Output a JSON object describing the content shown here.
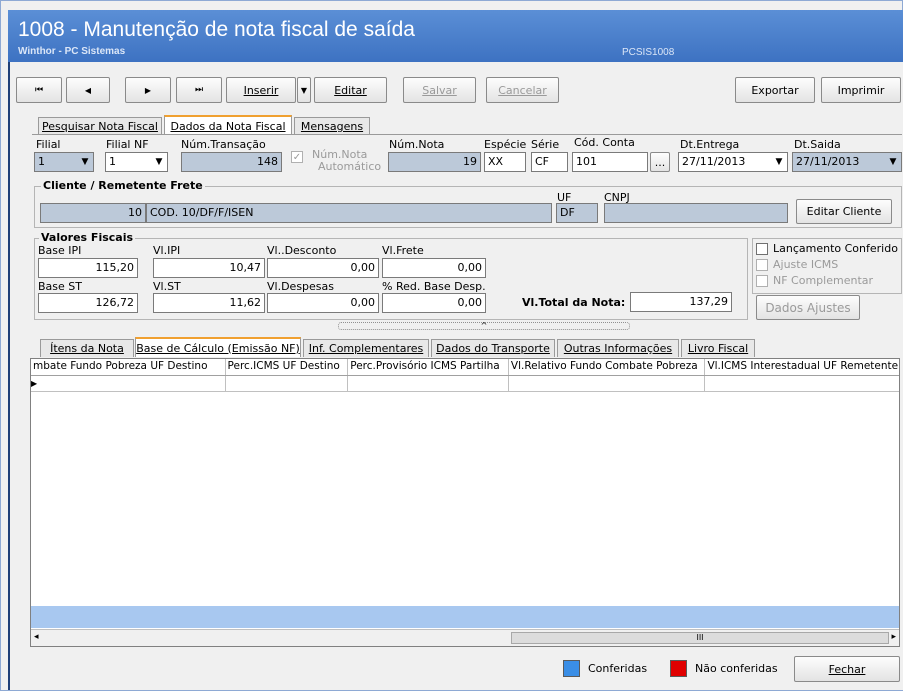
{
  "title": {
    "main": "1008 - Manutenção de nota fiscal de saída",
    "sub": "Winthor - PC Sistemas",
    "code": "PCSIS1008"
  },
  "toolbar": {
    "first": "⏮",
    "prev": "◀",
    "next": "▶",
    "last": "⏭",
    "inserir": "Inserir",
    "editar": "Editar",
    "salvar": "Salvar",
    "cancelar": "Cancelar",
    "exportar": "Exportar",
    "imprimir": "Imprimir"
  },
  "top_tabs": [
    "Pesquisar Nota Fiscal",
    "Dados da Nota Fiscal",
    "Mensagens"
  ],
  "header": {
    "filial_label": "Filial",
    "filial_value": "1",
    "filial_nf_label": "Filial NF",
    "filial_nf_value": "1",
    "num_transacao_label": "Núm.Transação",
    "num_transacao_value": "148",
    "num_nota_auto_label1": "Núm.Nota",
    "num_nota_auto_label2": "Automático",
    "num_nota_label": "Núm.Nota",
    "num_nota_value": "19",
    "especie_label": "Espécie",
    "especie_value": "XX",
    "serie_label": "Série",
    "serie_value": "CF",
    "cod_conta_label": "Cód. Conta",
    "cod_conta_value": "101",
    "ellipsis": "...",
    "dt_entrega_label": "Dt.Entrega",
    "dt_entrega_value": "27/11/2013",
    "dt_saida_label": "Dt.Saida",
    "dt_saida_value": "27/11/2013"
  },
  "cliente": {
    "group_title": "Cliente / Remetente Frete",
    "code": "10",
    "name": "COD. 10/DF/F/ISEN",
    "uf_label": "UF",
    "uf_value": "DF",
    "cnpj_label": "CNPJ",
    "cnpj_value": "",
    "editar_button": "Editar Cliente"
  },
  "valores": {
    "group_title": "Valores Fiscais",
    "base_ipi_label": "Base IPI",
    "base_ipi_value": "115,20",
    "vl_ipi_label": "Vl.IPI",
    "vl_ipi_value": "10,47",
    "vl_desconto_label": "Vl..Desconto",
    "vl_desconto_value": "0,00",
    "vl_frete_label": "Vl.Frete",
    "vl_frete_value": "0,00",
    "base_st_label": "Base ST",
    "base_st_value": "126,72",
    "vl_st_label": "Vl.ST",
    "vl_st_value": "11,62",
    "vl_despesas_label": "Vl.Despesas",
    "vl_despesas_value": "0,00",
    "red_base_label": "% Red. Base Desp.",
    "red_base_value": "0,00",
    "vl_total_label": "Vl.Total da Nota:",
    "vl_total_value": "137,29"
  },
  "checks": {
    "lancamento": "Lançamento Conferido",
    "ajuste_icms": "Ajuste ICMS",
    "nf_complementar": "NF Complementar",
    "dados_ajustes": "Dados Ajustes"
  },
  "bottom_tabs": [
    "Ítens da Nota",
    "Base de Cálculo (Emissão NF)",
    "Inf. Complementares",
    "Dados do Transporte",
    "Outras Informações",
    "Livro Fiscal"
  ],
  "grid_columns": [
    "mbate Fundo Pobreza UF Destino",
    "Perc.ICMS UF Destino",
    "Perc.Provisório ICMS Partilha",
    "Vl.Relativo Fundo Combate Pobreza",
    "Vl.ICMS Interestadual UF Remetente"
  ],
  "scroll_mid": "III",
  "legend": {
    "conferidas": "Conferidas",
    "nao_conferidas": "Não conferidas",
    "fechar": "Fechar"
  },
  "colors": {
    "title_bg": "#4a80cc",
    "conferidas": "#3a8ee6",
    "nao_conferidas": "#e00000",
    "tab_accent": "#f0a030"
  }
}
